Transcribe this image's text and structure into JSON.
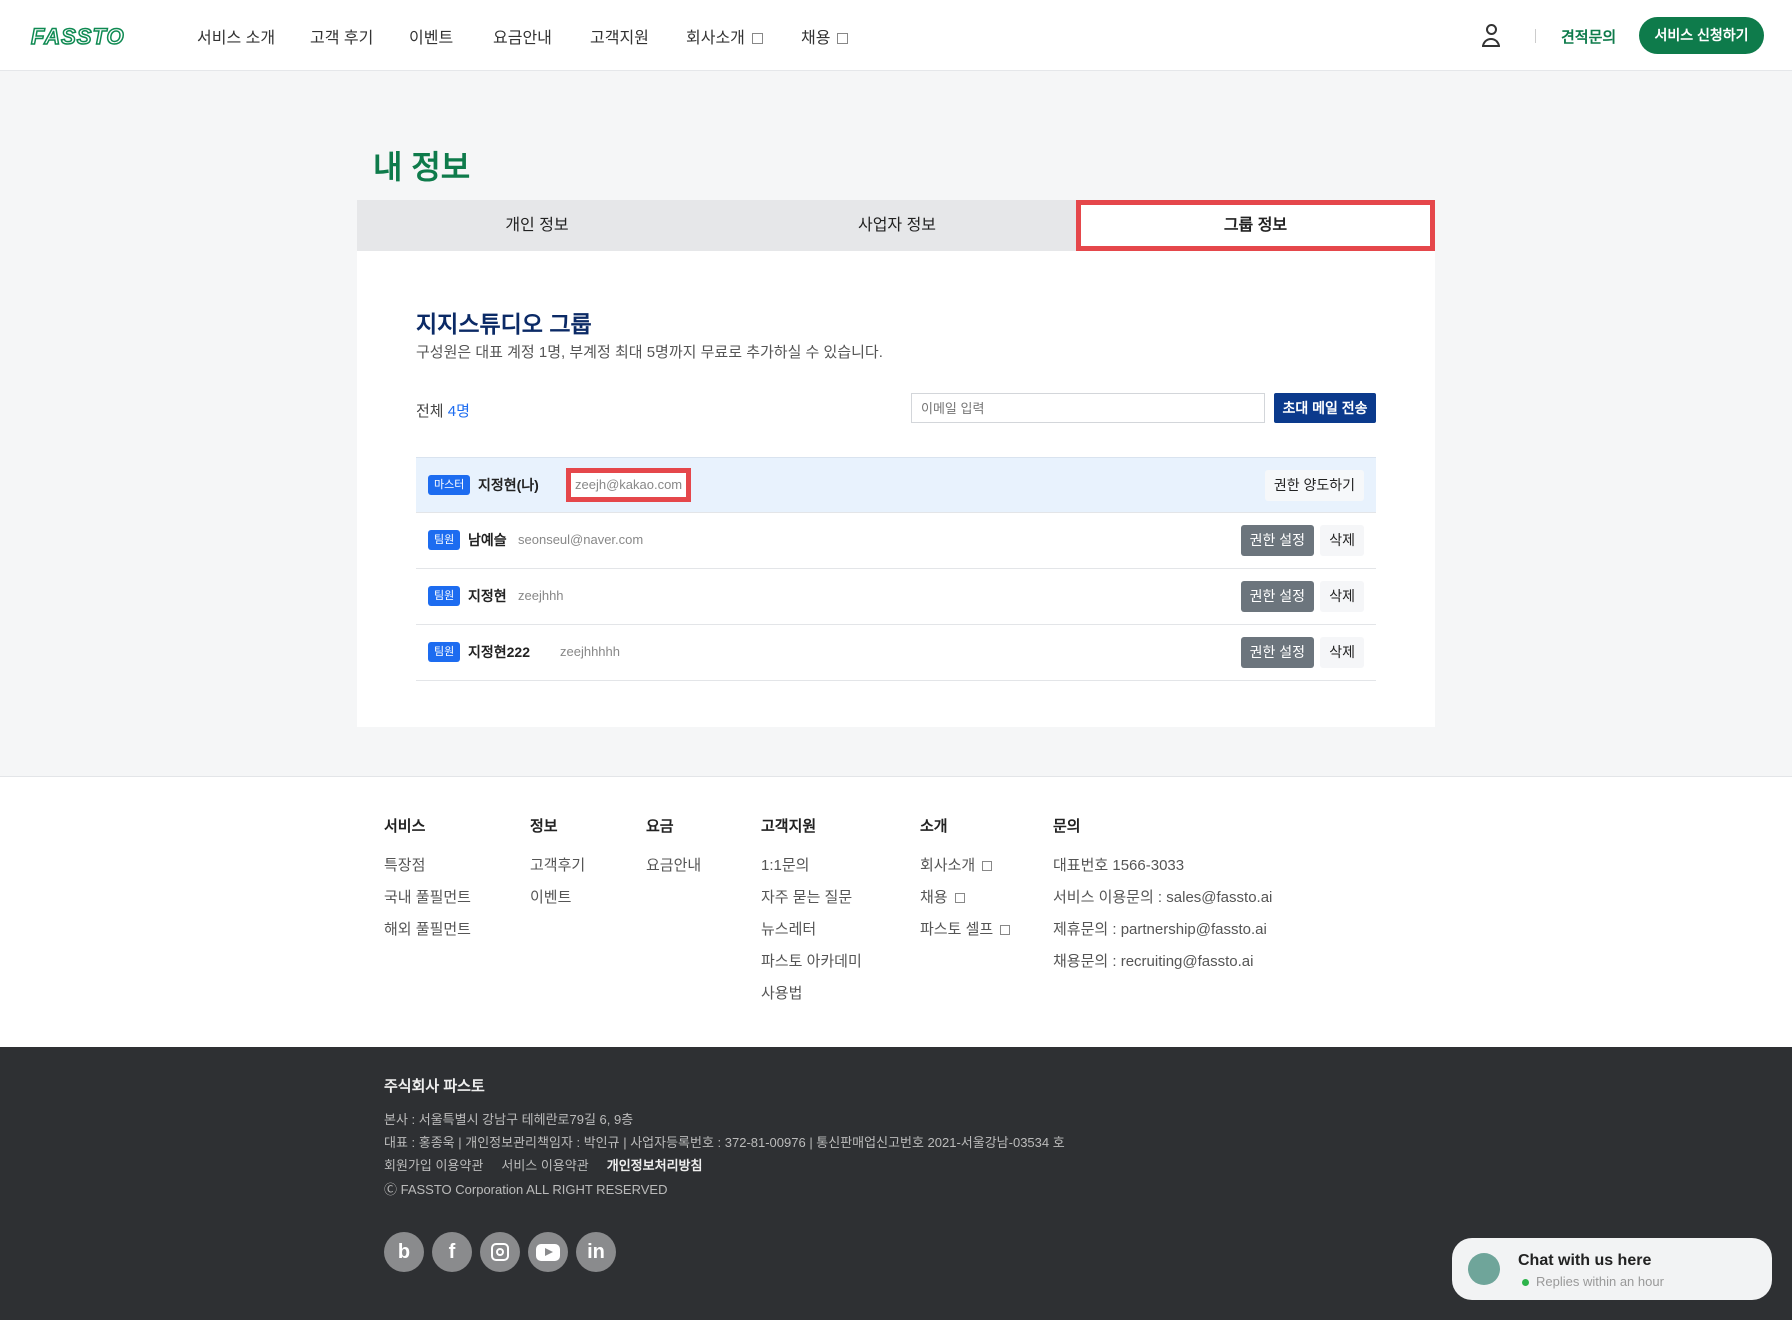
{
  "header": {
    "logo": "FASSTO",
    "nav": [
      {
        "label": "서비스 소개",
        "external": false
      },
      {
        "label": "고객 후기",
        "external": false
      },
      {
        "label": "이벤트",
        "external": false
      },
      {
        "label": "요금안내",
        "external": false
      },
      {
        "label": "고객지원",
        "external": false
      },
      {
        "label": "회사소개",
        "external": true
      },
      {
        "label": "채용",
        "external": true
      }
    ],
    "quote": "견적문의",
    "apply": "서비스 신청하기"
  },
  "page": {
    "title": "내 정보",
    "tabs": [
      "개인 정보",
      "사업자 정보",
      "그룹 정보"
    ],
    "active_tab": "그룹 정보"
  },
  "group": {
    "name": "지지스튜디오 그룹",
    "description": "구성원은 대표 계정 1명, 부계정 최대 5명까지 무료로 추가하실 수 있습니다.",
    "total_label": "전체",
    "total_count": "4명",
    "email_placeholder": "이메일 입력",
    "invite_button": "초대 메일 전송",
    "members": [
      {
        "role": "마스터",
        "name": "지정현(나)",
        "email": "zeejh@kakao.com",
        "actions": [
          "권한 양도하기"
        ]
      },
      {
        "role": "팀원",
        "name": "남예슬",
        "email": "seonseul@naver.com",
        "actions": [
          "권한 설정",
          "삭제"
        ]
      },
      {
        "role": "팀원",
        "name": "지정현",
        "email": "zeejhhh",
        "actions": [
          "권한 설정",
          "삭제"
        ]
      },
      {
        "role": "팀원",
        "name": "지정현222",
        "email": "zeejhhhhh",
        "actions": [
          "권한 설정",
          "삭제"
        ]
      }
    ]
  },
  "footer": {
    "columns": [
      {
        "title": "서비스",
        "links": [
          "특장점",
          "국내 풀필먼트",
          "해외 풀필먼트"
        ]
      },
      {
        "title": "정보",
        "links": [
          "고객후기",
          "이벤트"
        ]
      },
      {
        "title": "요금",
        "links": [
          "요금안내"
        ]
      },
      {
        "title": "고객지원",
        "links": [
          "1:1문의",
          "자주 묻는 질문",
          "뉴스레터",
          "파스토 아카데미",
          "사용법"
        ]
      },
      {
        "title": "소개",
        "links": [
          "회사소개",
          "채용",
          "파스토 셀프"
        ]
      },
      {
        "title": "문의",
        "links": [
          "대표번호 1566-3033",
          "서비스 이용문의 : sales@fassto.ai",
          "제휴문의 : partnership@fassto.ai",
          "채용문의 : recruiting@fassto.ai"
        ]
      }
    ],
    "company": "주식회사 파스토",
    "address": "본사 : 서울특별시 강남구 테헤란로79길 6, 9층",
    "info": "대표 : 홍종욱 | 개인정보관리책임자 : 박인규 | 사업자등록번호 : 372-81-00976 | 통신판매업신고번호 2021-서울강남-03534 호",
    "terms": [
      "회원가입 이용약관",
      "서비스 이용약관",
      "개인정보처리방침"
    ],
    "copyright": "Ⓒ FASSTO Corporation ALL RIGHT RESERVED",
    "social": [
      "b",
      "f",
      "instagram",
      "youtube",
      "in"
    ]
  },
  "chat": {
    "title": "Chat with us here",
    "subtitle": "Replies within an hour"
  },
  "colors": {
    "brand": "#0e7b4b",
    "highlight": "#e5474b",
    "badge": "#1d6cf0",
    "invite": "#0b3a8c"
  }
}
